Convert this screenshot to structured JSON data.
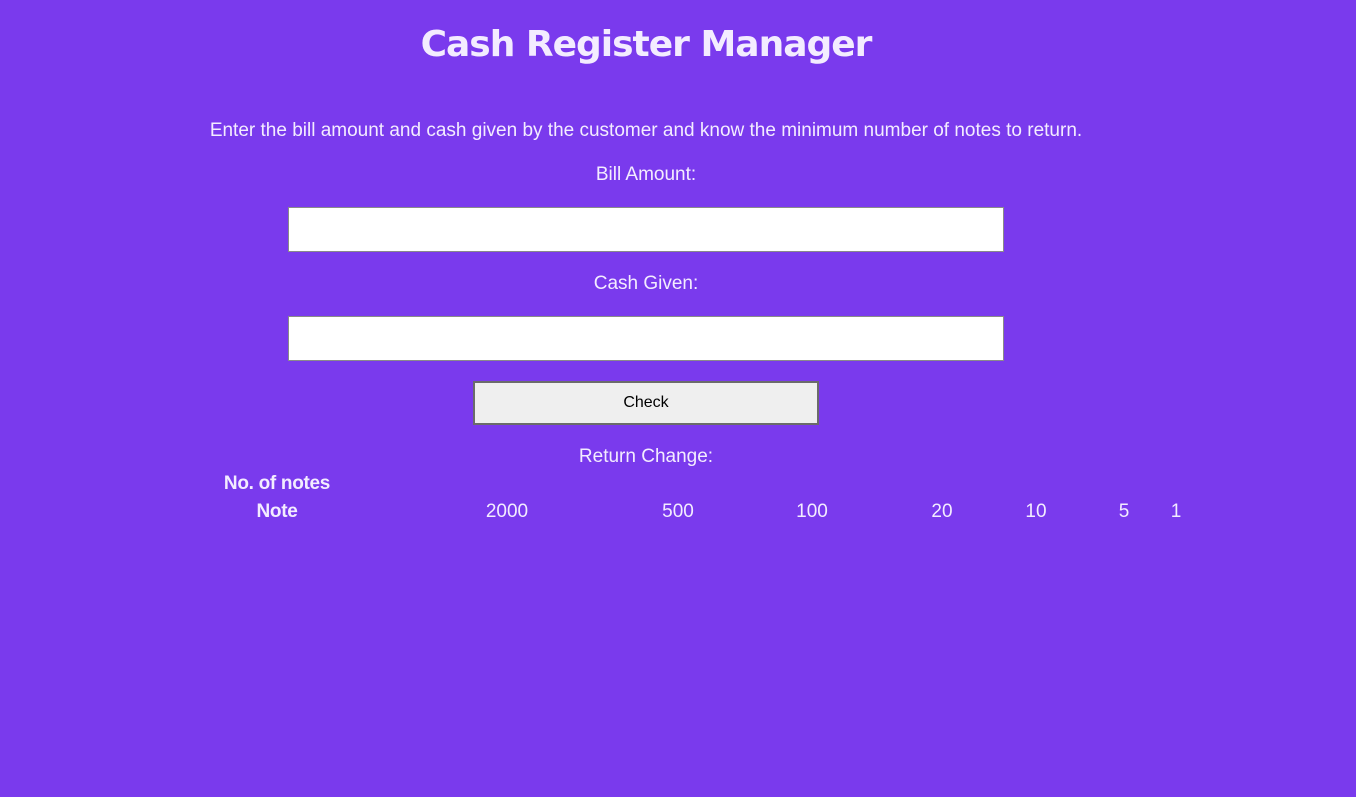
{
  "header": {
    "title": "Cash Register Manager",
    "description": "Enter the bill amount and cash given by the customer and know the minimum number of notes to return."
  },
  "form": {
    "bill_amount_label": "Bill Amount:",
    "bill_amount_value": "",
    "cash_given_label": "Cash Given:",
    "cash_given_value": "",
    "check_button_label": "Check"
  },
  "result": {
    "return_change_label": "Return Change:",
    "table": {
      "row_headers": [
        "No. of notes",
        "Note"
      ],
      "notes": [
        "2000",
        "500",
        "100",
        "20",
        "10",
        "5",
        "1"
      ],
      "counts": [
        "",
        "",
        "",
        "",
        "",
        "",
        ""
      ]
    }
  },
  "colors": {
    "background": "#7a3aed",
    "text": "#f3ecff",
    "input_background": "#ffffff",
    "button_background": "#efefef"
  }
}
